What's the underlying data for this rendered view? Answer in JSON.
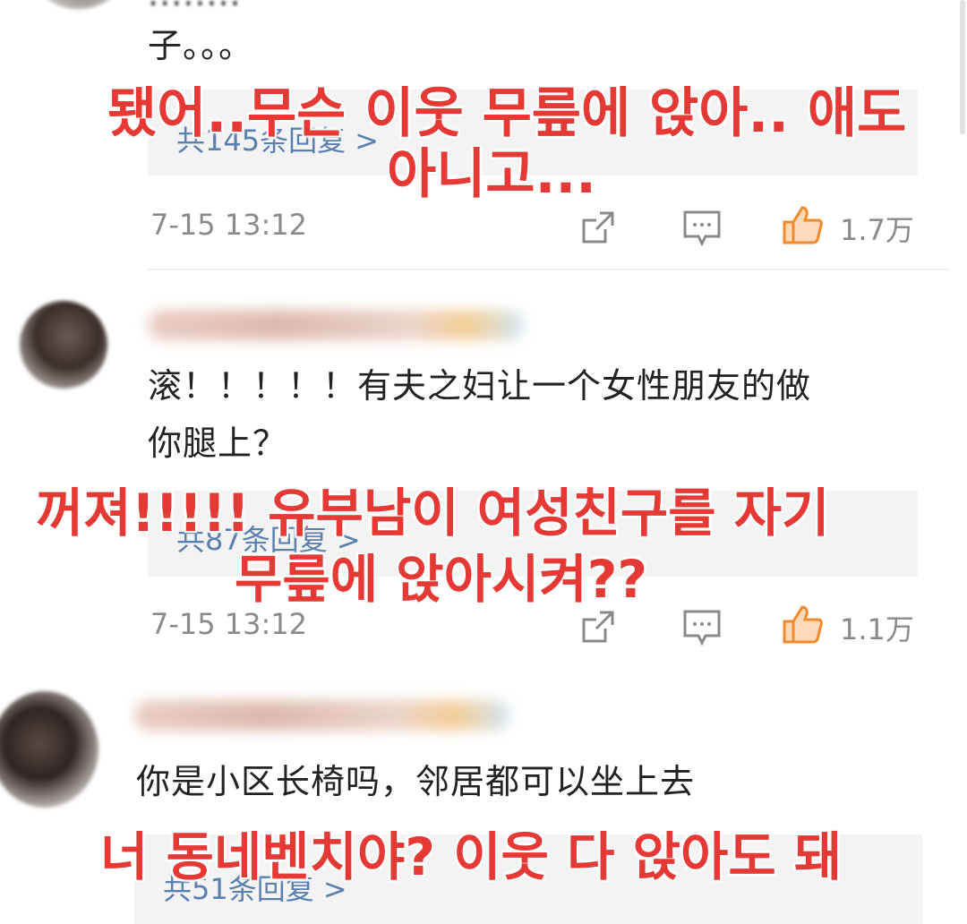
{
  "comments": [
    {
      "text_tail": "子。。。",
      "reply_label": "共145条回复 >",
      "time": "7-15 13:12",
      "likes": "1.7万",
      "translation_line1": "됐어..무슨 이웃 무릎에 앉아.. 애도",
      "translation_line2": "아니고..."
    },
    {
      "text_line1": "滚！！！！！有夫之妇让一个女性朋友的做",
      "text_line2": "你腿上？",
      "reply_label": "共87条回复 >",
      "time": "7-15 13:12",
      "likes": "1.1万",
      "translation_line1": "꺼져!!!!! 유부남이 여성친구를  자기",
      "translation_line2": "무릎에 앉아시켜??"
    },
    {
      "text_line1": "你是小区长椅吗，邻居都可以坐上去",
      "reply_label": "共51条回复 >",
      "translation_line1": "너 동네벤치야? 이웃 다 앉아도 돼"
    }
  ],
  "icons": [
    "share-icon",
    "comment-icon",
    "like-icon"
  ],
  "colors": {
    "overlay": "#e53935",
    "reply_link": "#5b7fae",
    "like_orange": "#f08a2c"
  }
}
